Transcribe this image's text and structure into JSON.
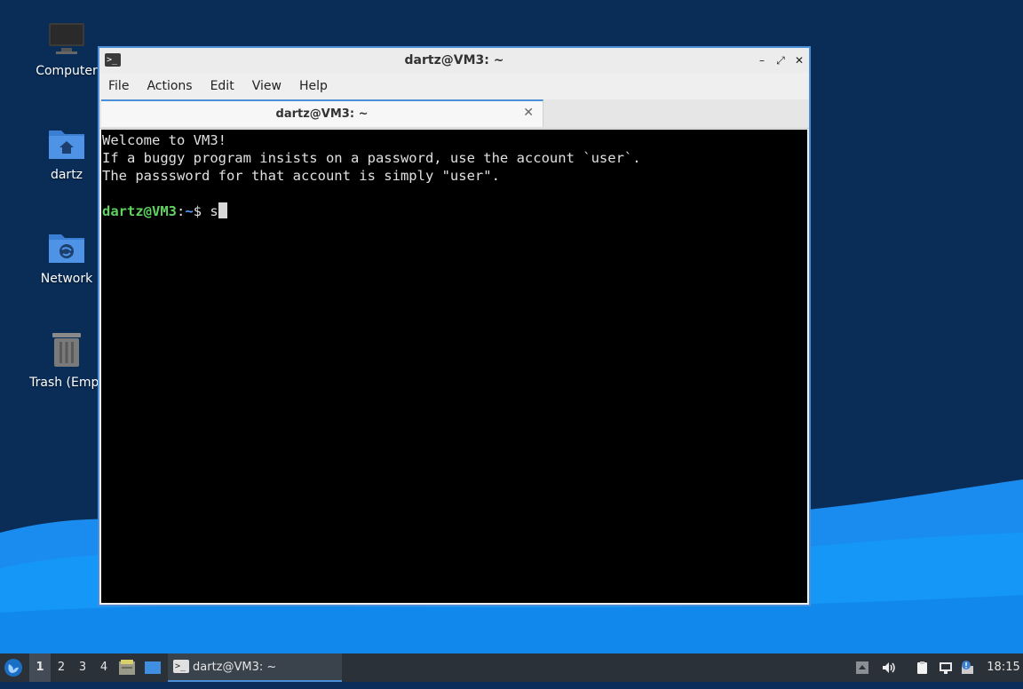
{
  "desktop": {
    "icons": [
      {
        "label": "Computer",
        "icon": "computer-icon"
      },
      {
        "label": "dartz",
        "icon": "home-folder-icon"
      },
      {
        "label": "Network",
        "icon": "network-folder-icon"
      },
      {
        "label": "Trash (Empt",
        "icon": "trash-icon"
      }
    ]
  },
  "window": {
    "title": "dartz@VM3: ~",
    "controls": {
      "minimize": "–",
      "maximize": "⤢",
      "close": "✕"
    },
    "menu": [
      "File",
      "Actions",
      "Edit",
      "View",
      "Help"
    ],
    "tab": {
      "label": "dartz@VM3: ~",
      "close": "✕"
    },
    "terminal": {
      "lines": [
        "Welcome to VM3!",
        "If a buggy program insists on a password, use the account `user`.",
        "The passsword for that account is simply \"user\"."
      ],
      "prompt_user": "dartz@VM3",
      "prompt_sep": ":",
      "prompt_path": "~",
      "prompt_symbol": "$ ",
      "input": "s"
    }
  },
  "taskbar": {
    "workspaces": [
      "1",
      "2",
      "3",
      "4"
    ],
    "active_workspace": "1",
    "task_label": "dartz@VM3: ~",
    "clock": "18:15"
  },
  "colors": {
    "accent": "#4a8fd8",
    "prompt_user": "#5fd35f",
    "prompt_path": "#5c9cff",
    "taskbar": "#2b3138"
  }
}
